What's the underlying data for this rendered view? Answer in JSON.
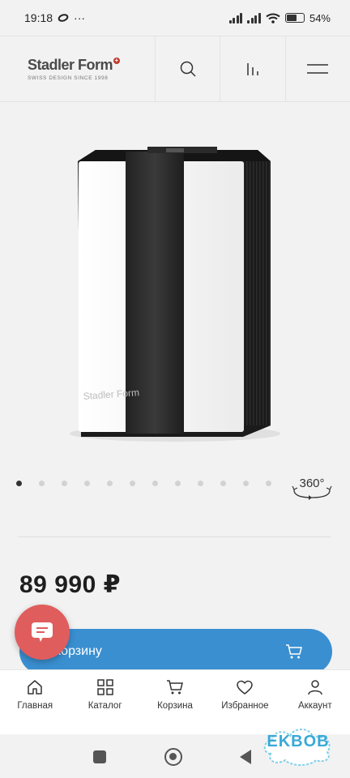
{
  "status_bar": {
    "time": "19:18",
    "extra": "···",
    "battery": "54%",
    "battery_level": 0.54
  },
  "header": {
    "brand": "Stadler Form",
    "tagline": "SWISS DESIGN SINCE 1998",
    "icons": [
      "search-icon",
      "compare-icon",
      "menu-icon"
    ]
  },
  "product": {
    "image_brand_text": "Stadler Form",
    "carousel_total": 12,
    "carousel_active": 1,
    "view360_label": "360°",
    "price": "89 990 ₽",
    "cart_button_label": "корзину"
  },
  "bottom_nav": {
    "items": [
      {
        "label": "Главная",
        "icon": "home-icon"
      },
      {
        "label": "Каталог",
        "icon": "catalog-icon"
      },
      {
        "label": "Корзина",
        "icon": "cart-icon"
      },
      {
        "label": "Избранное",
        "icon": "heart-icon"
      },
      {
        "label": "Аккаунт",
        "icon": "account-icon"
      }
    ]
  },
  "watermark": "EKBOB",
  "colors": {
    "accent": "#3a8fd0",
    "chat": "#e05d5d",
    "background": "#f2f2f2"
  }
}
